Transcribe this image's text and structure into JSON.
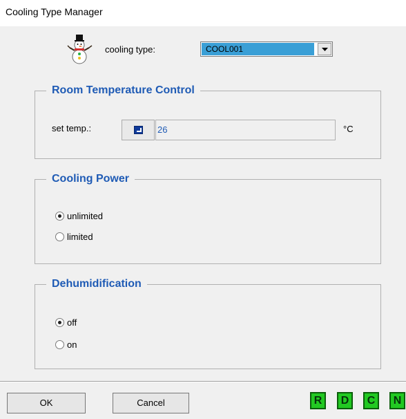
{
  "window": {
    "title": "Cooling Type Manager"
  },
  "cooling_type": {
    "label": "cooling type:",
    "selected": "COOL001"
  },
  "room_temperature": {
    "legend": "Room Temperature Control",
    "set_label": "set temp.:",
    "value": "26",
    "unit": "°C"
  },
  "cooling_power": {
    "legend": "Cooling Power",
    "options": [
      "unlimited",
      "limited"
    ],
    "selected": "unlimited"
  },
  "dehumidification": {
    "legend": "Dehumidification",
    "options": [
      "off",
      "on"
    ],
    "selected": "off"
  },
  "buttons": {
    "ok": "OK",
    "cancel": "Cancel"
  },
  "mode_buttons": [
    "R",
    "D",
    "C",
    "N"
  ],
  "colors": {
    "accent": "#1f5bb5",
    "select_highlight": "#3a9fd6",
    "mode_button": "#22c922"
  }
}
